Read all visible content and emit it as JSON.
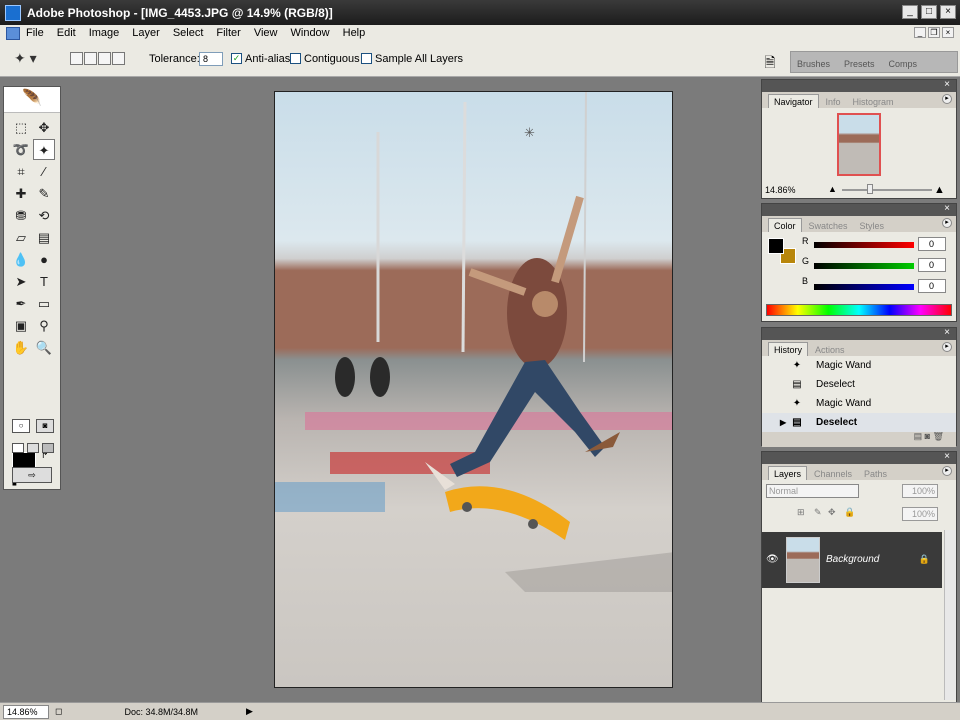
{
  "window": {
    "title": "Adobe Photoshop - [IMG_4453.JPG @ 14.9% (RGB/8)]",
    "btn_min": "_",
    "btn_max": "□",
    "btn_close": "×"
  },
  "menu": [
    "File",
    "Edit",
    "Image",
    "Layer",
    "Select",
    "Filter",
    "View",
    "Window",
    "Help"
  ],
  "options": {
    "tolerance_label": "Tolerance:",
    "tolerance_value": "8",
    "antialias_label": "Anti-alias",
    "antialias_checked": true,
    "contiguous_label": "Contiguous",
    "contiguous_checked": false,
    "sample_label": "Sample All Layers",
    "sample_checked": false
  },
  "palette_well": {
    "tabs": [
      "Brushes",
      "Presets",
      "Comps"
    ]
  },
  "navigator": {
    "tabs": [
      "Navigator",
      "Info",
      "Histogram"
    ],
    "zoom": "14.86%"
  },
  "color": {
    "tabs": [
      "Color",
      "Swatches",
      "Styles"
    ],
    "channels": [
      {
        "label": "R",
        "value": "0",
        "color": "#ff0000"
      },
      {
        "label": "G",
        "value": "0",
        "color": "#00cc00"
      },
      {
        "label": "B",
        "value": "0",
        "color": "#0000ff"
      }
    ]
  },
  "history": {
    "tabs": [
      "History",
      "Actions"
    ],
    "items": [
      {
        "label": "Magic Wand",
        "icon": "magic-wand-icon"
      },
      {
        "label": "Deselect",
        "icon": "history-state-icon"
      },
      {
        "label": "Magic Wand",
        "icon": "magic-wand-icon"
      },
      {
        "label": "Deselect",
        "icon": "history-state-icon",
        "active": true
      }
    ]
  },
  "layers": {
    "tabs": [
      "Layers",
      "Channels",
      "Paths"
    ],
    "blend_mode": "Normal",
    "opacity": "100%",
    "fill": "100%",
    "layer_name": "Background"
  },
  "status": {
    "zoom": "14.86%",
    "doc": "Doc: 34.8M/34.8M"
  },
  "colors": {
    "fg": "#000000",
    "bg": "#b8860b",
    "titlebar": "#1c1c1c"
  }
}
